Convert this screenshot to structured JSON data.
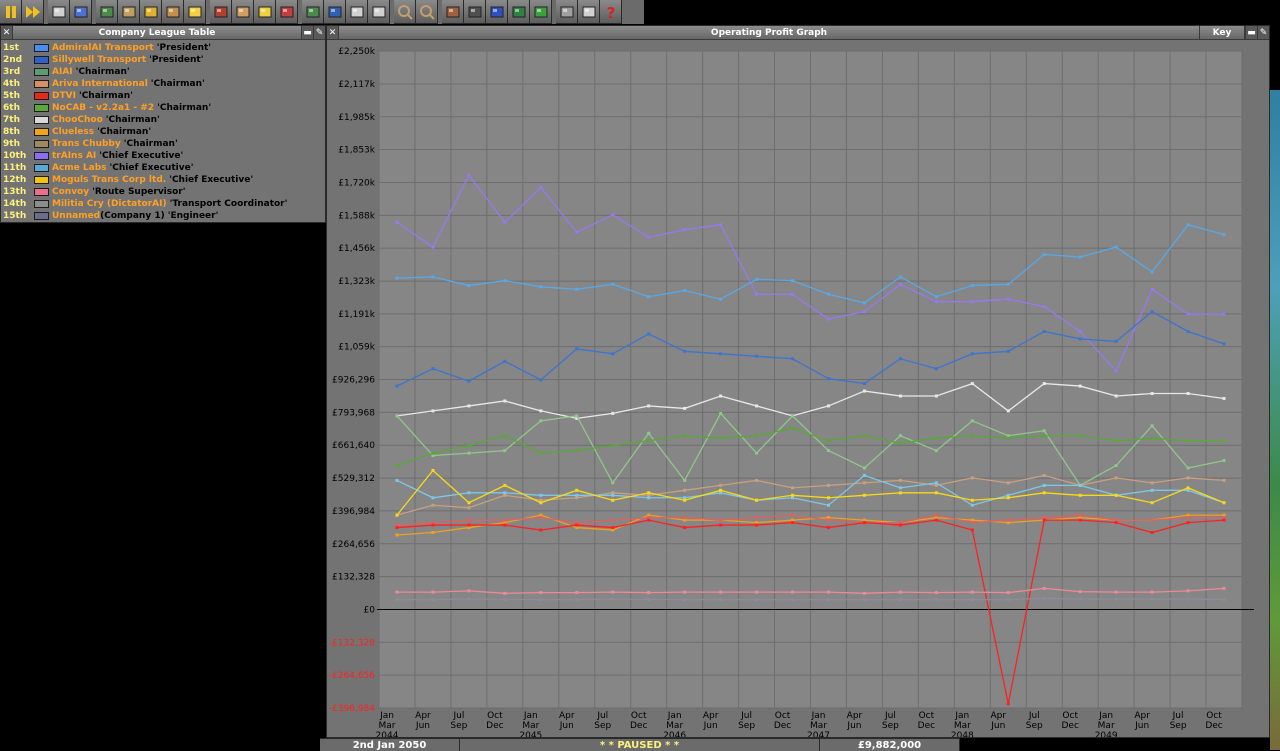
{
  "toolbar": {
    "buttons": [
      "pause-icon",
      "fast-forward-icon",
      "settings-icon",
      "save-icon",
      "minimap-icon",
      "town-directory-icon",
      "subsidies-icon",
      "station-list-icon",
      "finances-icon",
      "company-icon",
      "story-icon",
      "league-table-icon",
      "graphs-icon",
      "train-list-icon",
      "road-vehicle-list-icon",
      "ship-list-icon",
      "aircraft-list-icon",
      "zoom-in-icon",
      "zoom-out-icon",
      "build-rail-icon",
      "build-road-icon",
      "build-water-icon",
      "build-air-icon",
      "landscaping-icon",
      "music-icon",
      "messages-icon",
      "help-icon"
    ]
  },
  "league": {
    "title": "Company League Table",
    "rows": [
      {
        "rank": "1st",
        "color": "#4a8cf0",
        "name": "AdmiralAI Transport",
        "title": "'President'",
        "suffix": ""
      },
      {
        "rank": "2nd",
        "color": "#3060c8",
        "name": "Sillywell Transport",
        "title": "'President'",
        "suffix": ""
      },
      {
        "rank": "3rd",
        "color": "#5c9c70",
        "name": "AIAI",
        "title": "'Chairman'",
        "suffix": ""
      },
      {
        "rank": "4th",
        "color": "#d49060",
        "name": "Ariva International",
        "title": "'Chairman'",
        "suffix": ""
      },
      {
        "rank": "5th",
        "color": "#e82818",
        "name": "DTVI",
        "title": "'Chairman'",
        "suffix": ""
      },
      {
        "rank": "6th",
        "color": "#5ca838",
        "name": "NoCAB - v2.2a1 - #2",
        "title": "'Chairman'",
        "suffix": ""
      },
      {
        "rank": "7th",
        "color": "#d8d8d8",
        "name": "ChooChoo",
        "title": "'Chairman'",
        "suffix": ""
      },
      {
        "rank": "8th",
        "color": "#f0a418",
        "name": "Clueless",
        "title": "'Chairman'",
        "suffix": ""
      },
      {
        "rank": "9th",
        "color": "#a08860",
        "name": "Trans Chubby",
        "title": "'Chairman'",
        "suffix": ""
      },
      {
        "rank": "10th",
        "color": "#8c6cf0",
        "name": "trAIns AI",
        "title": "'Chief Executive'",
        "suffix": ""
      },
      {
        "rank": "11th",
        "color": "#58a8d8",
        "name": "Acme Labs",
        "title": "'Chief Executive'",
        "suffix": ""
      },
      {
        "rank": "12th",
        "color": "#f0c410",
        "name": "Moguls Trans Corp ltd.",
        "title": "'Chief Executive'",
        "suffix": ""
      },
      {
        "rank": "13th",
        "color": "#e87088",
        "name": "Convoy",
        "title": "'Route Supervisor'",
        "suffix": ""
      },
      {
        "rank": "14th",
        "color": "#8c8c8c",
        "name": "Militia Cry (DictatorAI)",
        "title": "'Transport Coordinator'",
        "suffix": ""
      },
      {
        "rank": "15th",
        "color": "#6c6c8c",
        "name": "Unnamed",
        "title": "'Engineer'",
        "suffix": "(Company 1)"
      }
    ]
  },
  "graph_window": {
    "title": "Operating Profit Graph",
    "key_label": "Key"
  },
  "chart_data": {
    "type": "line",
    "title": "Operating Profit Graph",
    "ylim": [
      -396984,
      2250000
    ],
    "y_ticks": [
      "£2,250k",
      "£2,117k",
      "£1,985k",
      "£1,853k",
      "£1,720k",
      "£1,588k",
      "£1,456k",
      "£1,323k",
      "£1,191k",
      "£1,059k",
      "£926,296",
      "£793,968",
      "£661,640",
      "£529,312",
      "£396,984",
      "£264,656",
      "£132,328",
      "£0",
      "-£132,328",
      "-£264,656",
      "-£396,984"
    ],
    "y_tick_values": [
      2250000,
      2117000,
      1985000,
      1853000,
      1720000,
      1588000,
      1456000,
      1323000,
      1191000,
      1059000,
      926296,
      793968,
      661640,
      529312,
      396984,
      264656,
      132328,
      0,
      -132328,
      -264656,
      -396984
    ],
    "x_labels": [
      {
        "m": "Jan",
        "y": "Mar",
        "yr": "2044"
      },
      {
        "m": "Apr",
        "y": "Jun",
        "yr": ""
      },
      {
        "m": "Jul",
        "y": "Sep",
        "yr": ""
      },
      {
        "m": "Oct",
        "y": "Dec",
        "yr": ""
      },
      {
        "m": "Jan",
        "y": "Mar",
        "yr": "2045"
      },
      {
        "m": "Apr",
        "y": "Jun",
        "yr": ""
      },
      {
        "m": "Jul",
        "y": "Sep",
        "yr": ""
      },
      {
        "m": "Oct",
        "y": "Dec",
        "yr": ""
      },
      {
        "m": "Jan",
        "y": "Mar",
        "yr": "2046"
      },
      {
        "m": "Apr",
        "y": "Jun",
        "yr": ""
      },
      {
        "m": "Jul",
        "y": "Sep",
        "yr": ""
      },
      {
        "m": "Oct",
        "y": "Dec",
        "yr": ""
      },
      {
        "m": "Jan",
        "y": "Mar",
        "yr": "2047"
      },
      {
        "m": "Apr",
        "y": "Jun",
        "yr": ""
      },
      {
        "m": "Jul",
        "y": "Sep",
        "yr": ""
      },
      {
        "m": "Oct",
        "y": "Dec",
        "yr": ""
      },
      {
        "m": "Jan",
        "y": "Mar",
        "yr": "2048"
      },
      {
        "m": "Apr",
        "y": "Jun",
        "yr": ""
      },
      {
        "m": "Jul",
        "y": "Sep",
        "yr": ""
      },
      {
        "m": "Oct",
        "y": "Dec",
        "yr": ""
      },
      {
        "m": "Jan",
        "y": "Mar",
        "yr": "2049"
      },
      {
        "m": "Apr",
        "y": "Jun",
        "yr": ""
      },
      {
        "m": "Jul",
        "y": "Sep",
        "yr": ""
      },
      {
        "m": "Oct",
        "y": "Dec",
        "yr": ""
      }
    ],
    "series": [
      {
        "color": "#9878f0",
        "values": [
          1560000,
          1460000,
          1750000,
          1560000,
          1700000,
          1520000,
          1590000,
          1500000,
          1530000,
          1550000,
          1270000,
          1270000,
          1170000,
          1200000,
          1310000,
          1240000,
          1240000,
          1250000,
          1220000,
          1120000,
          960000,
          1290000,
          1190000,
          1190000
        ]
      },
      {
        "color": "#58a8e8",
        "values": [
          1335000,
          1340000,
          1305000,
          1325000,
          1300000,
          1290000,
          1310000,
          1260000,
          1285000,
          1250000,
          1330000,
          1325000,
          1270000,
          1235000,
          1340000,
          1260000,
          1305000,
          1310000,
          1430000,
          1420000,
          1460000,
          1360000,
          1550000,
          1510000
        ]
      },
      {
        "color": "#3c74d0",
        "values": [
          900000,
          970000,
          920000,
          1000000,
          925000,
          1050000,
          1030000,
          1110000,
          1040000,
          1030000,
          1020000,
          1010000,
          930000,
          910000,
          1010000,
          970000,
          1030000,
          1040000,
          1120000,
          1090000,
          1080000,
          1200000,
          1120000,
          1070000
        ]
      },
      {
        "color": "#e8e8e8",
        "values": [
          780000,
          800000,
          820000,
          840000,
          800000,
          770000,
          790000,
          820000,
          810000,
          860000,
          820000,
          780000,
          820000,
          880000,
          860000,
          860000,
          910000,
          800000,
          910000,
          900000,
          860000,
          870000,
          870000,
          850000
        ]
      },
      {
        "color": "#8ec888",
        "values": [
          780000,
          620000,
          630000,
          640000,
          760000,
          780000,
          510000,
          710000,
          520000,
          790000,
          630000,
          780000,
          640000,
          570000,
          700000,
          640000,
          760000,
          700000,
          720000,
          500000,
          580000,
          740000,
          570000,
          600000
        ]
      },
      {
        "color": "#58a838",
        "values": [
          580000,
          630000,
          660000,
          700000,
          630000,
          640000,
          660000,
          680000,
          700000,
          690000,
          700000,
          730000,
          680000,
          700000,
          670000,
          690000,
          700000,
          690000,
          700000,
          700000,
          680000,
          690000,
          680000,
          680000
        ]
      },
      {
        "color": "#c8a080",
        "values": [
          380000,
          420000,
          410000,
          460000,
          440000,
          450000,
          470000,
          460000,
          480000,
          500000,
          520000,
          490000,
          500000,
          510000,
          520000,
          500000,
          530000,
          510000,
          540000,
          500000,
          530000,
          510000,
          530000,
          520000
        ]
      },
      {
        "color": "#7cc8e8",
        "values": [
          520000,
          450000,
          470000,
          470000,
          460000,
          460000,
          460000,
          450000,
          450000,
          470000,
          440000,
          450000,
          420000,
          540000,
          490000,
          510000,
          420000,
          460000,
          500000,
          500000,
          460000,
          480000,
          480000,
          430000
        ]
      },
      {
        "color": "#f8d818",
        "values": [
          380000,
          560000,
          430000,
          500000,
          430000,
          480000,
          440000,
          470000,
          440000,
          480000,
          440000,
          460000,
          450000,
          460000,
          470000,
          470000,
          440000,
          450000,
          470000,
          460000,
          460000,
          430000,
          490000,
          430000
        ]
      },
      {
        "color": "#f0a020",
        "values": [
          300000,
          310000,
          330000,
          350000,
          380000,
          330000,
          320000,
          380000,
          360000,
          360000,
          350000,
          360000,
          370000,
          360000,
          350000,
          370000,
          360000,
          350000,
          360000,
          370000,
          360000,
          360000,
          380000,
          380000
        ]
      },
      {
        "color": "#e06060",
        "values": [
          340000,
          350000,
          360000,
          360000,
          370000,
          350000,
          360000,
          370000,
          370000,
          360000,
          370000,
          380000,
          360000,
          350000,
          350000,
          380000,
          350000,
          360000,
          370000,
          380000,
          360000,
          360000,
          370000,
          370000
        ]
      },
      {
        "color": "#ff2020",
        "values": [
          330000,
          340000,
          340000,
          340000,
          320000,
          340000,
          330000,
          360000,
          330000,
          340000,
          340000,
          350000,
          330000,
          350000,
          340000,
          360000,
          320000,
          -380000,
          360000,
          360000,
          350000,
          310000,
          350000,
          360000
        ]
      },
      {
        "color": "#f08898",
        "values": [
          70000,
          70000,
          75000,
          65000,
          68000,
          68000,
          70000,
          68000,
          70000,
          70000,
          70000,
          70000,
          70000,
          65000,
          70000,
          68000,
          70000,
          68000,
          85000,
          72000,
          70000,
          70000,
          75000,
          85000
        ]
      },
      {
        "color": "#8c8c9c",
        "values": [
          40000,
          40000,
          42000,
          40000,
          40000,
          40000,
          42000,
          40000,
          40000,
          40000,
          40000,
          40000,
          40000,
          40000,
          40000,
          40000,
          40000,
          40000,
          45000,
          42000,
          42000,
          42000,
          42000,
          40000
        ]
      }
    ]
  },
  "status": {
    "date": "2nd Jan 2050",
    "paused": "* * PAUSED * *",
    "money": "£9,882,000"
  }
}
